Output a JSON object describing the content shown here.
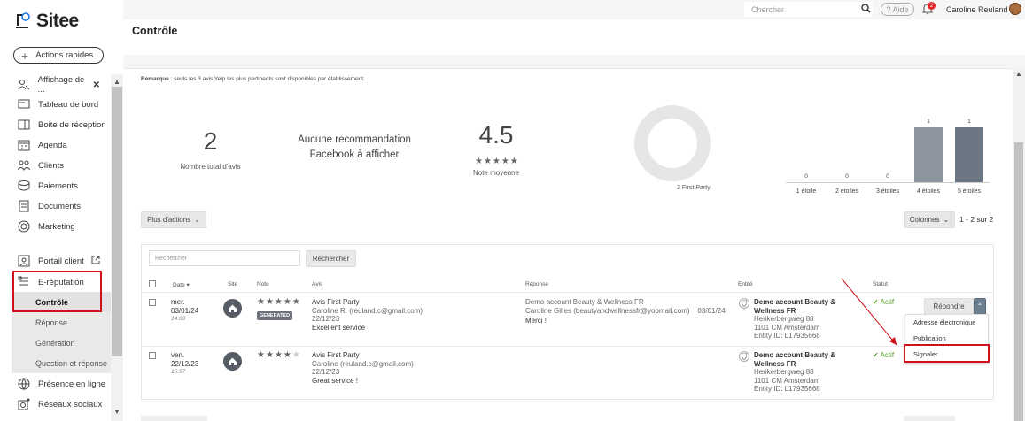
{
  "brand": {
    "name": "Sitee"
  },
  "sidebar": {
    "quick_actions": "Actions rapides",
    "items": [
      {
        "label": "Affichage de ...",
        "icon": "people-icon"
      },
      {
        "label": "Tableau de bord",
        "icon": "dashboard-icon"
      },
      {
        "label": "Boite de réception",
        "icon": "inbox-icon"
      },
      {
        "label": "Agenda",
        "icon": "calendar-icon"
      },
      {
        "label": "Clients",
        "icon": "clients-icon"
      },
      {
        "label": "Paiements",
        "icon": "payments-icon"
      },
      {
        "label": "Documents",
        "icon": "document-icon"
      },
      {
        "label": "Marketing",
        "icon": "target-icon"
      },
      {
        "label": "Portail client",
        "icon": "portal-icon"
      },
      {
        "label": "E-réputation",
        "icon": "reputation-icon"
      },
      {
        "label": "Présence en ligne",
        "icon": "globe-icon"
      },
      {
        "label": "Réseaux sociaux",
        "icon": "social-icon"
      }
    ],
    "close_symbol": "✕",
    "subitems": [
      "Contrôle",
      "Réponse",
      "Génération",
      "Question et réponse"
    ]
  },
  "header": {
    "search_placeholder": "Chercher",
    "help": "? Aide",
    "notif_count": "2",
    "user": "Caroline Reuland"
  },
  "page": {
    "title": "Contrôle",
    "remark_label": "Remarque",
    "remark": " : seuls les 3 avis Yelp les plus pertinents sont disponibles par établissement."
  },
  "stats": {
    "total": "2",
    "total_label": "Nombre total d'avis",
    "facebook_line1": "Aucune recommandation",
    "facebook_line2": "Facebook à afficher",
    "avg": "4.5",
    "avg_stars": "★★★★★",
    "avg_label": "Note moyenne"
  },
  "chart_data": [
    {
      "type": "pie",
      "categories": [
        "First Party"
      ],
      "values": [
        2
      ],
      "legend": "2 First Party",
      "colors": [
        "#e6e6e6"
      ]
    },
    {
      "type": "bar",
      "categories": [
        "1 étoile",
        "2 étoiles",
        "3 étoiles",
        "4 étoiles",
        "5 étoiles"
      ],
      "values": [
        0,
        0,
        0,
        1,
        1
      ],
      "colors": [
        "#8c959f",
        "#6b7785"
      ]
    }
  ],
  "toolbar": {
    "more_actions": "Plus d'actions",
    "columns": "Colonnes",
    "pagination": "1 - 2 sur 2"
  },
  "table": {
    "search_placeholder": "Rechercher",
    "search_button": "Rechercher",
    "headers": [
      "Date",
      "Site",
      "Note",
      "Avis",
      "Réponse",
      "Entité",
      "Statut"
    ],
    "rows": [
      {
        "day": "mer.",
        "date": "03/01/24",
        "time": "14:00",
        "stars": "★★★★★",
        "badge": "GENERATED",
        "review_title": "Avis First Party",
        "review_author": "Caroline R.  (reuland.c@gmail.com)",
        "review_date": "22/12/23",
        "review_text": "Excellent service",
        "reply_account": "Demo account Beauty & Wellness FR",
        "reply_author": "Caroline Gilles (beautyandwellnessfr@yopmail.com)",
        "reply_date": "03/01/24",
        "reply_text": "Merci !",
        "entity_name": "Demo account Beauty & Wellness FR",
        "entity_street": "Herikerbergweg 88",
        "entity_city": "1101 CM Amsterdam",
        "entity_id": "Entity ID: L17935668",
        "status": "✔ Actif",
        "action": "Répondre"
      },
      {
        "day": "ven.",
        "date": "22/12/23",
        "time": "15:57",
        "stars": "★★★★★",
        "review_title": "Avis First Party",
        "review_author": "Caroline  (reuland.c@gmail.com)",
        "review_date": "22/12/23",
        "review_text": "Great service !",
        "entity_name": "Demo account Beauty & Wellness FR",
        "entity_street": "Herikerbergweg 88",
        "entity_city": "1101 CM Amsterdam",
        "entity_id": "Entity ID: L17935668",
        "status": "✔ Actif"
      }
    ]
  },
  "dropdown": {
    "items": [
      "Adresse électronique",
      "Publication",
      "Signaler"
    ]
  },
  "colors": {
    "accent_red": "#d0111b",
    "success": "#5aa02c",
    "bar_dark": "#6b7785",
    "bar_mid": "#8c959f"
  }
}
